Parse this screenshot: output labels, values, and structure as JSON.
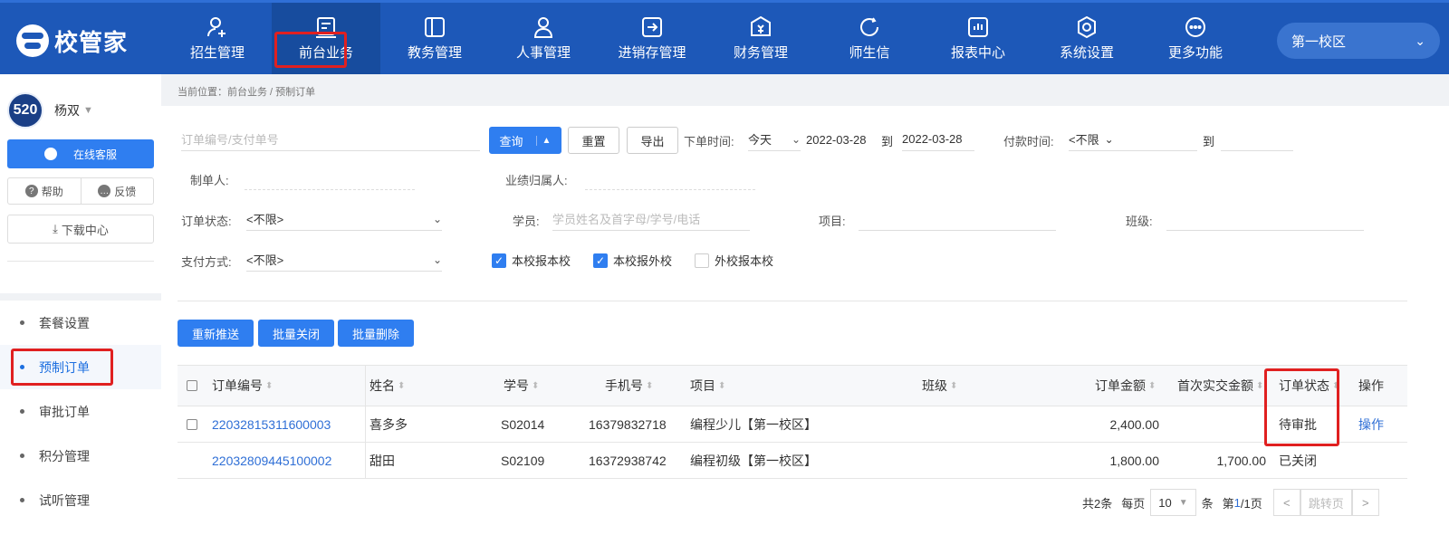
{
  "logo": {
    "text": "校管家"
  },
  "nav": [
    {
      "label": "招生管理",
      "icon": "user-add-icon"
    },
    {
      "label": "前台业务",
      "icon": "front-desk-icon",
      "active": true
    },
    {
      "label": "教务管理",
      "icon": "book-icon"
    },
    {
      "label": "人事管理",
      "icon": "person-icon"
    },
    {
      "label": "进销存管理",
      "icon": "inventory-icon"
    },
    {
      "label": "财务管理",
      "icon": "finance-icon"
    },
    {
      "label": "师生信",
      "icon": "message-icon"
    },
    {
      "label": "报表中心",
      "icon": "report-icon"
    },
    {
      "label": "系统设置",
      "icon": "settings-icon"
    },
    {
      "label": "更多功能",
      "icon": "more-icon"
    }
  ],
  "campus": {
    "label": "第一校区"
  },
  "user": {
    "avatar_text": "520",
    "name": "杨双"
  },
  "sidebar": {
    "service_label": "在线客服",
    "help_label": "帮助",
    "feedback_label": "反馈",
    "download_label": "下载中心",
    "menu": [
      {
        "label": "套餐设置"
      },
      {
        "label": "预制订单",
        "active": true
      },
      {
        "label": "审批订单"
      },
      {
        "label": "积分管理"
      },
      {
        "label": "试听管理"
      }
    ]
  },
  "breadcrumb": "当前位置：前台业务 / 预制订单",
  "filters": {
    "order_no_placeholder": "订单编号/支付单号",
    "query_label": "查询",
    "reset_label": "重置",
    "export_label": "导出",
    "order_time_label": "下单时间:",
    "order_time_preset": "今天",
    "date_from": "2022-03-28",
    "date_to_sep": "到",
    "date_to": "2022-03-28",
    "pay_time_label": "付款时间:",
    "pay_time_value": "<不限",
    "pay_to_sep": "到",
    "creator_label": "制单人:",
    "owner_label": "业绩归属人:",
    "status_label": "订单状态:",
    "status_value": "<不限>",
    "student_label": "学员:",
    "student_placeholder": "学员姓名及首字母/学号/电话",
    "project_label": "项目:",
    "class_label": "班级:",
    "pay_method_label": "支付方式:",
    "pay_method_value": "<不限>",
    "check1": "本校报本校",
    "check2": "本校报外校",
    "check3": "外校报本校"
  },
  "actions": {
    "repush": "重新推送",
    "batch_close": "批量关闭",
    "batch_delete": "批量删除"
  },
  "table": {
    "headers": {
      "order_no": "订单编号",
      "name": "姓名",
      "student_no": "学号",
      "phone": "手机号",
      "project": "项目",
      "class": "班级",
      "amount": "订单金额",
      "first_paid": "首次实交金额",
      "status": "订单状态",
      "ops": "操作"
    },
    "rows": [
      {
        "order_no": "22032815311600003",
        "name": "喜多多",
        "student_no": "S02014",
        "phone": "16379832718",
        "project": "编程少儿【第一校区】",
        "class": "",
        "amount": "2,400.00",
        "first_paid": "",
        "status": "待审批",
        "ops": "操作"
      },
      {
        "order_no": "22032809445100002",
        "name": "甜田",
        "student_no": "S02109",
        "phone": "16372938742",
        "project": "编程初级【第一校区】",
        "class": "",
        "amount": "1,800.00",
        "first_paid": "1,700.00",
        "status": "已关闭",
        "ops": ""
      }
    ]
  },
  "pager": {
    "total": "共2条",
    "per_page_label": "每页",
    "per_page": "10",
    "unit": "条",
    "page_prefix": "第",
    "page_current": "1",
    "page_rest": "/1页",
    "jump_placeholder": "跳转页"
  }
}
